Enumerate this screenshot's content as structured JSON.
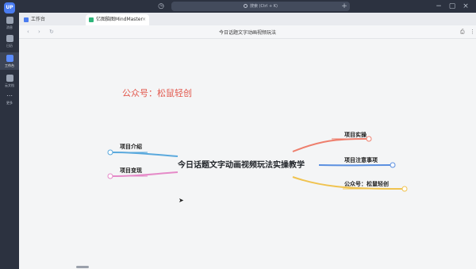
{
  "sidebar": {
    "logo": "UP",
    "items": [
      {
        "label": "消息",
        "icon": "message-icon",
        "active": false
      },
      {
        "label": "日历",
        "icon": "calendar-icon",
        "active": false
      },
      {
        "label": "工作台",
        "icon": "workbench-icon",
        "active": true
      },
      {
        "label": "云文档",
        "icon": "cloud-doc-icon",
        "active": false
      },
      {
        "label": "更多",
        "icon": "more-icon",
        "active": false
      }
    ]
  },
  "titlebar": {
    "search_placeholder": "搜索 (Ctrl + K)",
    "history_icon": "history-icon",
    "add_icon": "plus-icon"
  },
  "tabs": [
    {
      "label": "工作台",
      "active": false,
      "icon_color": "#4a7cf0"
    },
    {
      "label": "亿图脑图MindMaster",
      "active": true,
      "icon_color": "#2fb57a"
    }
  ],
  "toolbar": {
    "doc_title": "今日话题文字动画视频玩法"
  },
  "canvas": {
    "watermark": "公众号：松鼠轻创",
    "root": "今日话题文字动画视频玩法实操教学",
    "left_nodes": [
      {
        "label": "项目介绍",
        "color": "#5aa9dd"
      },
      {
        "label": "项目变现",
        "color": "#e58ac8"
      }
    ],
    "right_nodes": [
      {
        "label": "项目实操",
        "color": "#ee7f6d"
      },
      {
        "label": "项目注意事项",
        "color": "#5a8fe0"
      },
      {
        "label": "公众号：松鼠轻创",
        "color": "#f0c350"
      }
    ]
  }
}
